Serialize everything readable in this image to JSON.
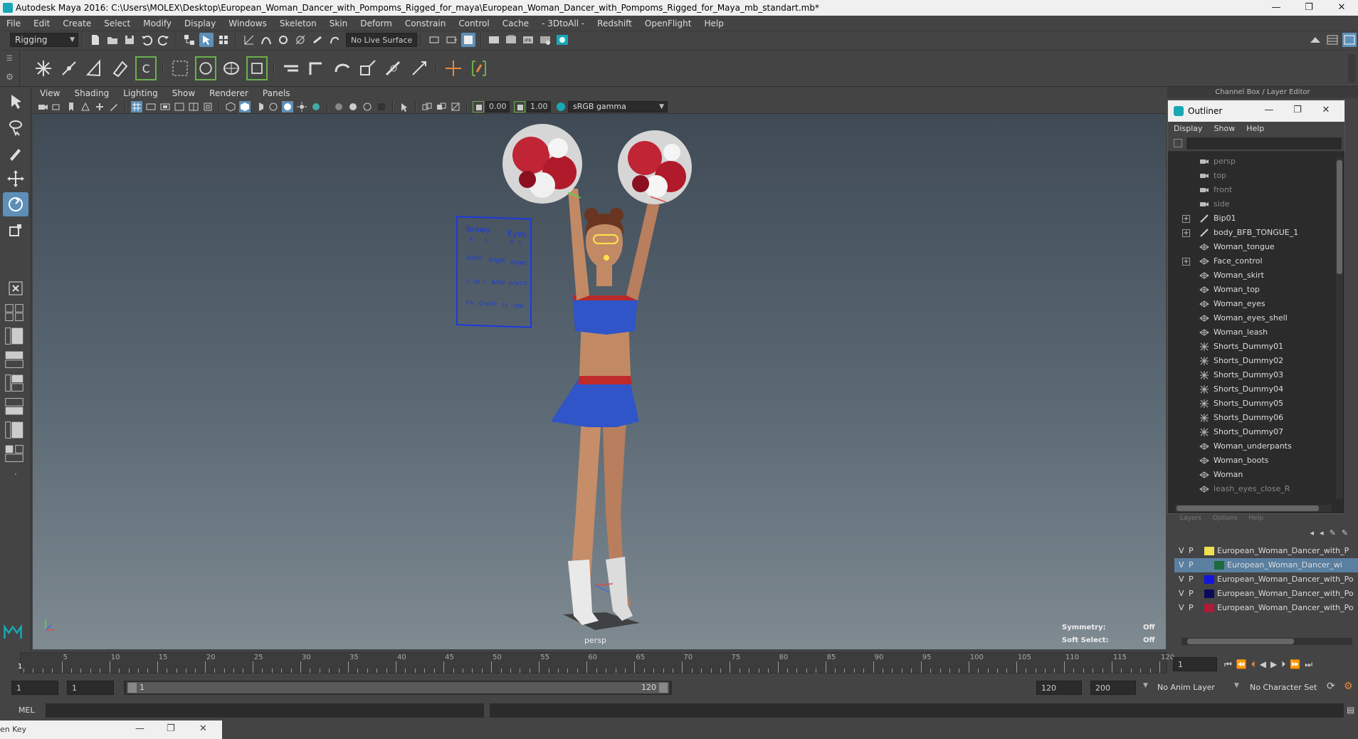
{
  "window": {
    "title": "Autodesk Maya 2016: C:\\Users\\MOLEX\\Desktop\\European_Woman_Dancer_with_Pompoms_Rigged_for_maya\\European_Woman_Dancer_with_Pompoms_Rigged_for_Maya_mb_standart.mb*",
    "minimize": "—",
    "restore": "❐",
    "close": "✕"
  },
  "menubar": [
    "File",
    "Edit",
    "Create",
    "Select",
    "Modify",
    "Display",
    "Windows",
    "Skeleton",
    "Skin",
    "Deform",
    "Constrain",
    "Control",
    "Cache",
    "- 3DtoAll -",
    "Redshift",
    "OpenFlight",
    "Help"
  ],
  "status": {
    "mode": "Rigging",
    "live_surface": "No Live Surface"
  },
  "viewport": {
    "menu": [
      "View",
      "Shading",
      "Lighting",
      "Show",
      "Renderer",
      "Panels"
    ],
    "field_a": "0.00",
    "field_b": "1.00",
    "color_space": "sRGB gamma",
    "camera_label": "persp",
    "symmetry_label": "Symmetry:",
    "symmetry_value": "Off",
    "soft_select_label": "Soft Select:",
    "soft_select_value": "Off",
    "face_panel": {
      "brows": "Brows",
      "eyes": "Eyes",
      "r": "R",
      "l": "L",
      "r2": "R",
      "l2": "L",
      "smile": "Smile",
      "fright": "Fright",
      "anger": "Anger",
      "o": "O",
      "ue": "UE",
      "i": "I",
      "bmp": "B/M/P",
      "dstz": "D/S/T/Z",
      "fv": "F/V",
      "chjsh": "Ch/J/Sh",
      "th": "Th",
      "qw": "Q/W"
    }
  },
  "channel_box": {
    "title": "Channel Box / Layer Editor"
  },
  "outliner": {
    "title": "Outliner",
    "menu": [
      "Display",
      "Show",
      "Help"
    ],
    "items": [
      {
        "label": "persp",
        "type": "camera",
        "dim": true,
        "expand": false
      },
      {
        "label": "top",
        "type": "camera",
        "dim": true,
        "expand": false
      },
      {
        "label": "front",
        "type": "camera",
        "dim": true,
        "expand": false
      },
      {
        "label": "side",
        "type": "camera",
        "dim": true,
        "expand": false
      },
      {
        "label": "Bip01",
        "type": "joint",
        "dim": false,
        "expand": true
      },
      {
        "label": "body_BFB_TONGUE_1",
        "type": "joint",
        "dim": false,
        "expand": true
      },
      {
        "label": "Woman_tongue",
        "type": "mesh",
        "dim": false,
        "expand": false
      },
      {
        "label": "Face_control",
        "type": "mesh",
        "dim": false,
        "expand": true
      },
      {
        "label": "Woman_skirt",
        "type": "mesh",
        "dim": false,
        "expand": false
      },
      {
        "label": "Woman_top",
        "type": "mesh",
        "dim": false,
        "expand": false
      },
      {
        "label": "Woman_eyes",
        "type": "mesh",
        "dim": false,
        "expand": false
      },
      {
        "label": "Woman_eyes_shell",
        "type": "mesh",
        "dim": false,
        "expand": false
      },
      {
        "label": "Woman_leash",
        "type": "mesh",
        "dim": false,
        "expand": false
      },
      {
        "label": "Shorts_Dummy01",
        "type": "dummy",
        "dim": false,
        "expand": false
      },
      {
        "label": "Shorts_Dummy02",
        "type": "dummy",
        "dim": false,
        "expand": false
      },
      {
        "label": "Shorts_Dummy03",
        "type": "dummy",
        "dim": false,
        "expand": false
      },
      {
        "label": "Shorts_Dummy04",
        "type": "dummy",
        "dim": false,
        "expand": false
      },
      {
        "label": "Shorts_Dummy05",
        "type": "dummy",
        "dim": false,
        "expand": false
      },
      {
        "label": "Shorts_Dummy06",
        "type": "dummy",
        "dim": false,
        "expand": false
      },
      {
        "label": "Shorts_Dummy07",
        "type": "dummy",
        "dim": false,
        "expand": false
      },
      {
        "label": "Woman_underpants",
        "type": "mesh",
        "dim": false,
        "expand": false
      },
      {
        "label": "Woman_boots",
        "type": "mesh",
        "dim": false,
        "expand": false
      },
      {
        "label": "Woman",
        "type": "mesh",
        "dim": false,
        "expand": false
      },
      {
        "label": "leash_eyes_close_R",
        "type": "mesh",
        "dim": true,
        "expand": false
      }
    ]
  },
  "layers": {
    "menu": [
      "Layers",
      "Options",
      "Help"
    ],
    "rows": [
      {
        "v": "V",
        "p": "P",
        "color": "#f0e050",
        "name": "European_Woman_Dancer_with_P",
        "selected": false
      },
      {
        "v": "V",
        "p": "P",
        "color": "#1d6b3c",
        "name": "European_Woman_Dancer_wi",
        "selected": true
      },
      {
        "v": "V",
        "p": "P",
        "color": "#1414e0",
        "name": "European_Woman_Dancer_with_Po",
        "selected": false
      },
      {
        "v": "V",
        "p": "P",
        "color": "#0a0a5a",
        "name": "European_Woman_Dancer_with_Po",
        "selected": false
      },
      {
        "v": "V",
        "p": "P",
        "color": "#b01a3a",
        "name": "European_Woman_Dancer_with_Po",
        "selected": false
      }
    ]
  },
  "timeline": {
    "start": 1,
    "end": 120,
    "major_ticks": [
      5,
      10,
      15,
      20,
      25,
      30,
      35,
      40,
      45,
      50,
      55,
      60,
      65,
      70,
      75,
      80,
      85,
      90,
      95,
      100,
      105,
      110,
      115,
      120
    ],
    "current_frame_label": "1",
    "current_frame_field": "1"
  },
  "range": {
    "start_field": "1",
    "playback_start": "1",
    "slider_start": "1",
    "slider_end": "120",
    "end_field": "120",
    "max_field": "200",
    "anim_layer": "No Anim Layer",
    "char_set": "No Character Set"
  },
  "cmdline": {
    "label": "MEL"
  },
  "helpline": {
    "text": "en Key"
  },
  "colors": {
    "accent_blue": "#5d8fb8",
    "maya_teal": "#1aa7b5"
  }
}
